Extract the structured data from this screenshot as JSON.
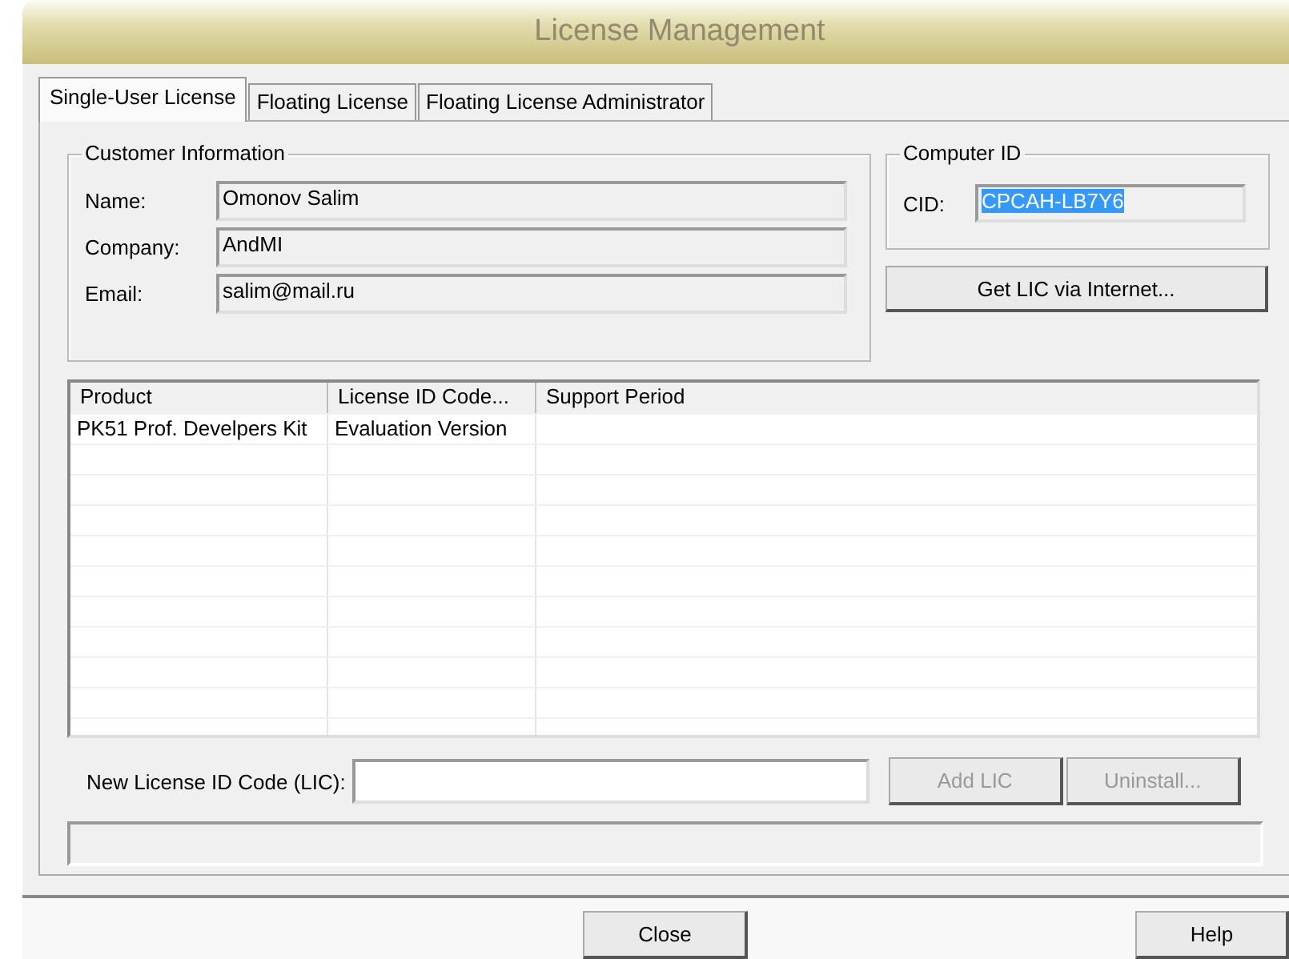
{
  "window": {
    "title": "License Management"
  },
  "tabs": [
    {
      "label": "Single-User License",
      "selected": true
    },
    {
      "label": "Floating License",
      "selected": false
    },
    {
      "label": "Floating License Administrator",
      "selected": false
    }
  ],
  "customer_information": {
    "title": "Customer Information",
    "fields": [
      {
        "label": "Name:",
        "value": "Omonov Salim"
      },
      {
        "label": "Company:",
        "value": "AndMI"
      },
      {
        "label": "Email:",
        "value": "salim@mail.ru"
      }
    ]
  },
  "computer_id": {
    "title": "Computer ID",
    "label": "CID:",
    "value": "CPCAH-LB7Y6",
    "selected": true
  },
  "get_lic_button": {
    "label": "Get LIC via Internet...",
    "disabled": false
  },
  "table": {
    "columns": [
      "Product",
      "License ID Code...",
      "Support Period"
    ],
    "rows": [
      [
        "PK51 Prof. Develpers Kit",
        "Evaluation Version",
        ""
      ]
    ]
  },
  "new_lic": {
    "label": "New License ID Code (LIC):"
  },
  "action_buttons": [
    {
      "label": "Add LIC",
      "disabled": true
    },
    {
      "label": "Uninstall...",
      "disabled": true
    }
  ],
  "footer_buttons": [
    {
      "label": "Close",
      "disabled": false
    },
    {
      "label": "Help",
      "disabled": false
    }
  ]
}
